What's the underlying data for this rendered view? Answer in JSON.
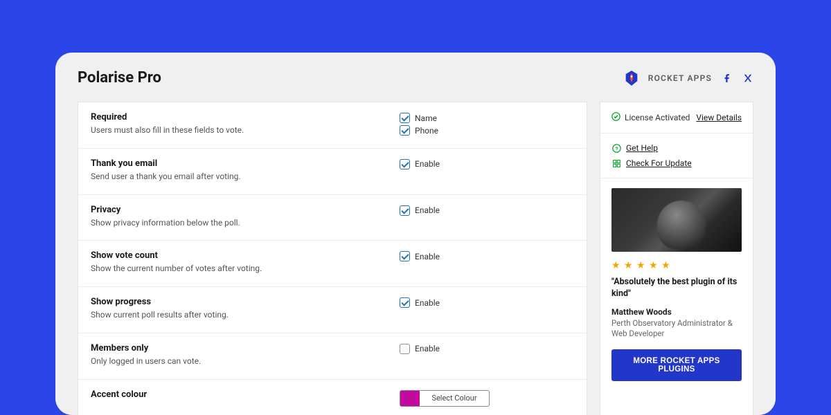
{
  "header": {
    "title": "Polarise Pro",
    "brand": "ROCKET APPS"
  },
  "settings": [
    {
      "title": "Required",
      "desc": "Users must also fill in these fields to vote.",
      "options": [
        {
          "label": "Name",
          "checked": true
        },
        {
          "label": "Phone",
          "checked": true
        }
      ]
    },
    {
      "title": "Thank you email",
      "desc": "Send user a thank you email after voting.",
      "options": [
        {
          "label": "Enable",
          "checked": true
        }
      ]
    },
    {
      "title": "Privacy",
      "desc": "Show privacy information below the poll.",
      "options": [
        {
          "label": "Enable",
          "checked": true
        }
      ]
    },
    {
      "title": "Show vote count",
      "desc": "Show the current number of votes after voting.",
      "options": [
        {
          "label": "Enable",
          "checked": true
        }
      ]
    },
    {
      "title": "Show progress",
      "desc": "Show current poll results after voting.",
      "options": [
        {
          "label": "Enable",
          "checked": true
        }
      ]
    },
    {
      "title": "Members only",
      "desc": "Only logged in users can vote.",
      "options": [
        {
          "label": "Enable",
          "checked": false
        }
      ]
    },
    {
      "title": "Accent colour",
      "desc": "",
      "colour": {
        "swatch": "#c20a9e",
        "label": "Select Colour"
      }
    }
  ],
  "sidebar": {
    "license_status": "License Activated",
    "view_details": "View Details",
    "help_links": [
      {
        "label": "Get Help",
        "icon": "question-circle-icon"
      },
      {
        "label": "Check For Update",
        "icon": "update-icon"
      }
    ],
    "testimonial": {
      "quote": "\"Absolutely the best plugin of its kind\"",
      "author": "Matthew Woods",
      "role": "Perth Observatory Administrator & Web Developer",
      "stars": 5
    },
    "cta": "MORE ROCKET APPS PLUGINS"
  }
}
